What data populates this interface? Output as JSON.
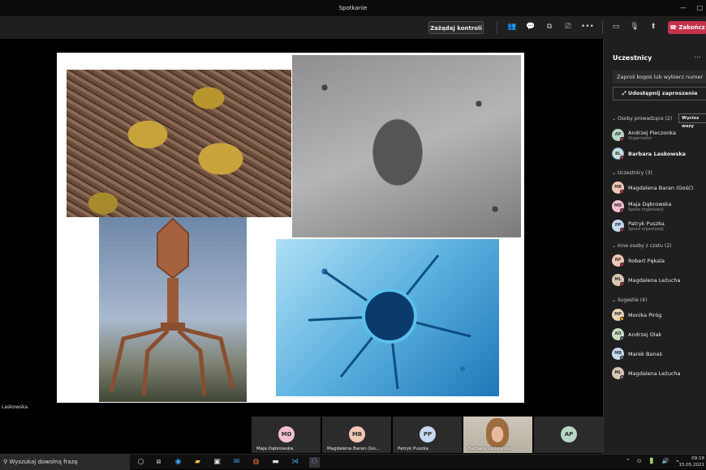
{
  "window": {
    "title": "Spotkanie",
    "controls": [
      "—",
      "□"
    ]
  },
  "toolbar": {
    "request_control": "Zażądaj kontroli",
    "end_call": "Zakończ",
    "more": "•••"
  },
  "presenter": {
    "name": "Laskowska"
  },
  "panel": {
    "title": "Uczestnicy",
    "more": "…",
    "invite_placeholder": "Zaproś kogoś lub wybierz numer",
    "share_invite": "Udostępnij zaproszenie",
    "mute_all": "Wycisz wszy",
    "sections": [
      {
        "label": "Osoby prowadzące (2)",
        "people": [
          {
            "initials": "AP",
            "name": "Andrzej Pieczonka",
            "sub": "Organizator",
            "color": "#b9d6c4"
          },
          {
            "initials": "BL",
            "name": "Barbara Laskowska",
            "sub": "",
            "color": "#c9e3d5"
          }
        ]
      },
      {
        "label": "Uczestnicy (3)",
        "people": [
          {
            "initials": "MB",
            "name": "Magdalena Baran (Gość)",
            "sub": "",
            "color": "#f2c7b4"
          },
          {
            "initials": "MD",
            "name": "Maja Dąbrowska",
            "sub": "Spoza organizacji",
            "color": "#f3bfd0"
          },
          {
            "initials": "PP",
            "name": "Patryk Puszka",
            "sub": "Spoza organizacji",
            "color": "#c5d9ef"
          }
        ]
      },
      {
        "label": "Inne osoby z czatu (2)",
        "people": [
          {
            "initials": "RP",
            "name": "Robert Pękala",
            "sub": "",
            "color": "#f2c7b4"
          },
          {
            "initials": "ML",
            "name": "Magdalena Leżucha",
            "sub": "",
            "color": "#d8c9b4"
          }
        ]
      },
      {
        "label": "Sugestie (4)",
        "people": [
          {
            "initials": "MP",
            "name": "Monika Piróg",
            "sub": "",
            "color": "#e8d2b8"
          },
          {
            "initials": "AO",
            "name": "Andrzej Olak",
            "sub": "",
            "color": "#c9dcc3"
          },
          {
            "initials": "MB",
            "name": "Marek Banaś",
            "sub": "",
            "color": "#c5d9ef"
          },
          {
            "initials": "ML",
            "name": "Magdalena Leżucha",
            "sub": "",
            "color": "#d8c9b4"
          }
        ]
      }
    ]
  },
  "gallery": [
    {
      "initials": "MD",
      "label": "Maja Dąbrowska",
      "color": "#f3bfd0"
    },
    {
      "initials": "MB",
      "label": "Magdalena Baran (Go...",
      "color": "#f2c7b4"
    },
    {
      "initials": "PP",
      "label": "Patryk Puszka",
      "color": "#c5d9ef"
    },
    {
      "initials": "",
      "label": "Barbara Laskowska",
      "color": ""
    },
    {
      "initials": "AP",
      "label": "",
      "color": "#b9d6c4"
    }
  ],
  "taskbar": {
    "search_placeholder": "Wyszukaj dowolną frazę",
    "time": "09:18",
    "date": "15.05.2021"
  }
}
